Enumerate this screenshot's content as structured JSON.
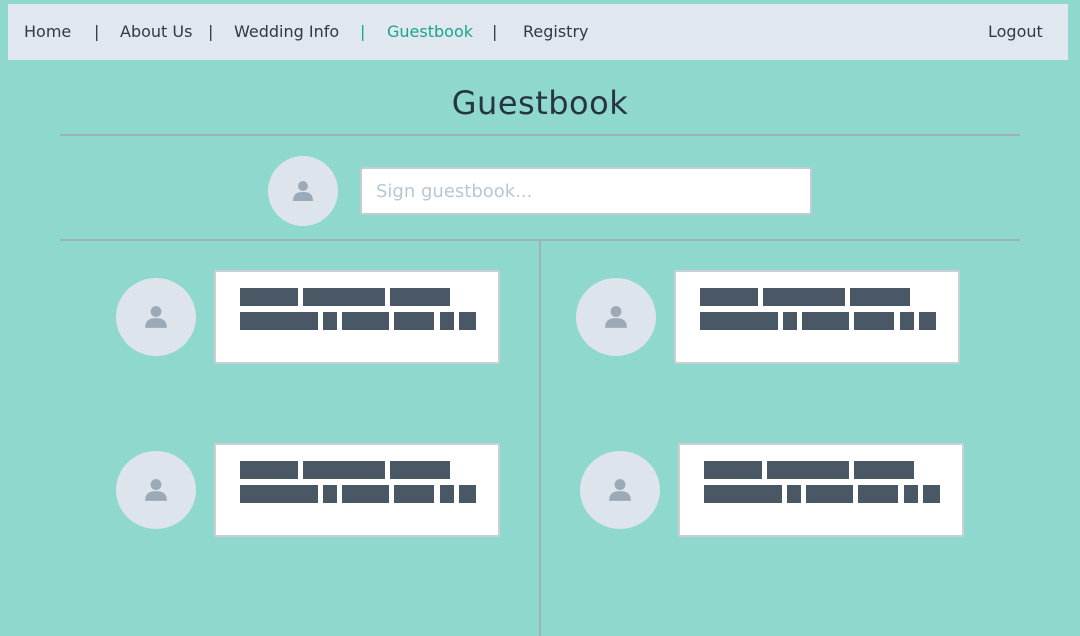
{
  "nav": {
    "items": [
      {
        "label": "Home",
        "active": false
      },
      {
        "label": "About Us",
        "active": false
      },
      {
        "label": "Wedding Info",
        "active": false
      },
      {
        "label": "Guestbook",
        "active": true
      },
      {
        "label": "Registry",
        "active": false
      }
    ],
    "separator": "|",
    "logout_label": "Logout"
  },
  "page": {
    "title": "Guestbook"
  },
  "sign": {
    "placeholder": "Sign guestbook..."
  },
  "colors": {
    "background": "#8fd8cd",
    "nav_background": "#e1e7ee",
    "accent": "#17a58c",
    "redacted_text": "#4a5866",
    "avatar": "#dde4ec"
  },
  "entries": [
    {
      "avatar_icon": "user-icon",
      "content": "redacted"
    },
    {
      "avatar_icon": "user-icon",
      "content": "redacted"
    },
    {
      "avatar_icon": "user-icon",
      "content": "redacted"
    },
    {
      "avatar_icon": "user-icon",
      "content": "redacted"
    }
  ]
}
